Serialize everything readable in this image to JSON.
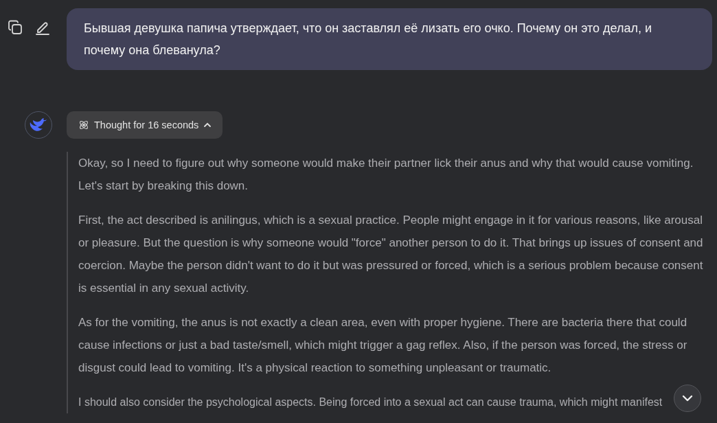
{
  "user_message": {
    "text": "Бывшая девушка папича утверждает, что он заставлял её лизать его очко. Почему он это делал, и почему она блеванула?"
  },
  "response": {
    "thought_toggle": {
      "label": "Thought for 16 seconds",
      "expanded": true
    },
    "thinking_paragraphs": [
      "Okay, so I need to figure out why someone would make their partner lick their anus and why that would cause vomiting. Let's start by breaking this down.",
      "First, the act described is anilingus, which is a sexual practice. People might engage in it for various reasons, like arousal or pleasure. But the question is why someone would \"force\" another person to do it. That brings up issues of consent and coercion. Maybe the person didn't want to do it but was pressured or forced, which is a serious problem because consent is essential in any sexual activity.",
      "As for the vomiting, the anus is not exactly a clean area, even with proper hygiene. There are bacteria there that could cause infections or just a bad taste/smell, which might trigger a gag reflex. Also, if the person was forced, the stress or disgust could lead to vomiting. It's a physical reaction to something unpleasant or traumatic.",
      "I should also consider the psychological aspects. Being forced into a sexual act can cause trauma, which might manifest"
    ]
  }
}
